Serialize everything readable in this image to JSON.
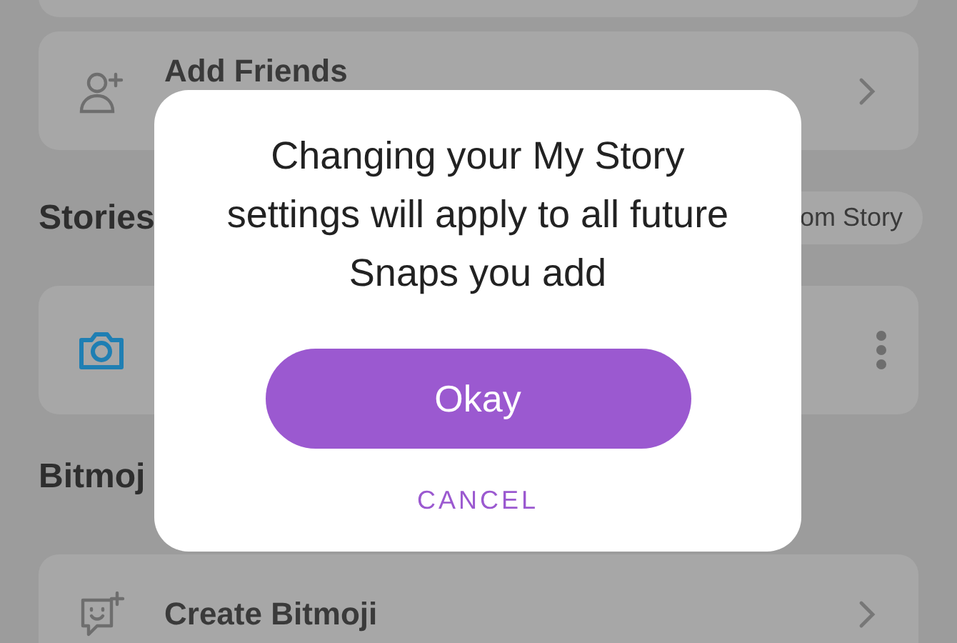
{
  "friends_row": {
    "label": "Add Friends"
  },
  "stories_section": {
    "heading": "Stories",
    "action": "om Story"
  },
  "bitmoji_section": {
    "heading": "Bitmoj",
    "row_label": "Create Bitmoji"
  },
  "dialog": {
    "message": "Changing your My Story settings will apply to all future Snaps you add",
    "primary_button": "Okay",
    "secondary_button": "CANCEL"
  }
}
